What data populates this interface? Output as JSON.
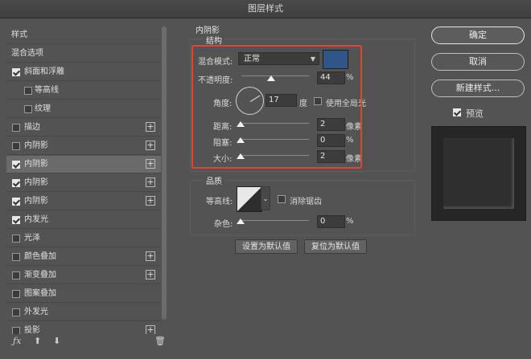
{
  "window": {
    "title": "图层样式"
  },
  "left_panel": {
    "header": "样式",
    "items": [
      {
        "label": "混合选项",
        "checkbox": false,
        "has_checkbox": false,
        "plus": false,
        "indent": false,
        "selected": false
      },
      {
        "label": "斜面和浮雕",
        "checkbox": true,
        "has_checkbox": true,
        "plus": false,
        "indent": false,
        "selected": false
      },
      {
        "label": "等高线",
        "checkbox": false,
        "has_checkbox": true,
        "plus": false,
        "indent": true,
        "selected": false
      },
      {
        "label": "纹理",
        "checkbox": false,
        "has_checkbox": true,
        "plus": false,
        "indent": true,
        "selected": false
      },
      {
        "label": "描边",
        "checkbox": false,
        "has_checkbox": true,
        "plus": true,
        "indent": false,
        "selected": false
      },
      {
        "label": "内阴影",
        "checkbox": false,
        "has_checkbox": true,
        "plus": true,
        "indent": false,
        "selected": false
      },
      {
        "label": "内阴影",
        "checkbox": true,
        "has_checkbox": true,
        "plus": true,
        "indent": false,
        "selected": true
      },
      {
        "label": "内阴影",
        "checkbox": true,
        "has_checkbox": true,
        "plus": true,
        "indent": false,
        "selected": false
      },
      {
        "label": "内阴影",
        "checkbox": true,
        "has_checkbox": true,
        "plus": true,
        "indent": false,
        "selected": false
      },
      {
        "label": "内发光",
        "checkbox": true,
        "has_checkbox": true,
        "plus": false,
        "indent": false,
        "selected": false
      },
      {
        "label": "光泽",
        "checkbox": false,
        "has_checkbox": true,
        "plus": false,
        "indent": false,
        "selected": false
      },
      {
        "label": "颜色叠加",
        "checkbox": false,
        "has_checkbox": true,
        "plus": true,
        "indent": false,
        "selected": false
      },
      {
        "label": "渐变叠加",
        "checkbox": false,
        "has_checkbox": true,
        "plus": true,
        "indent": false,
        "selected": false
      },
      {
        "label": "图案叠加",
        "checkbox": false,
        "has_checkbox": true,
        "plus": false,
        "indent": false,
        "selected": false
      },
      {
        "label": "外发光",
        "checkbox": false,
        "has_checkbox": true,
        "plus": false,
        "indent": false,
        "selected": false
      },
      {
        "label": "投影",
        "checkbox": false,
        "has_checkbox": true,
        "plus": true,
        "indent": false,
        "selected": false
      }
    ],
    "footer_icons": [
      "fx-icon",
      "arrow-up-icon",
      "arrow-down-icon",
      "trash-icon"
    ]
  },
  "inner_shadow": {
    "section_title": "内阴影",
    "structure_title": "结构",
    "blend_mode_label": "混合模式:",
    "blend_mode_value": "正常",
    "shadow_color": "#2f5686",
    "opacity_label": "不透明度:",
    "opacity_value": "44",
    "opacity_unit": "%",
    "opacity_level": 0.44,
    "angle_label": "角度:",
    "angle_value": "17",
    "angle_unit": "度",
    "global_light_label": "使用全局光",
    "global_light_checked": false,
    "distance_label": "距离:",
    "distance_value": "2",
    "distance_unit": "像素",
    "choke_label": "阻塞:",
    "choke_value": "0",
    "choke_unit": "%",
    "size_label": "大小:",
    "size_value": "2",
    "size_unit": "像素",
    "quality_title": "品质",
    "contour_label": "等高线:",
    "anti_alias_label": "消除锯齿",
    "anti_alias_checked": false,
    "noise_label": "杂色:",
    "noise_value": "0",
    "noise_unit": "%",
    "set_default_label": "设置为默认值",
    "reset_default_label": "复位为默认值"
  },
  "right_panel": {
    "ok_label": "确定",
    "cancel_label": "取消",
    "new_style_label": "新建样式...",
    "preview_label": "预览",
    "preview_checked": true
  },
  "colors": {
    "highlight_box": "#e2452b",
    "selected_row": "#6a6a6a"
  }
}
